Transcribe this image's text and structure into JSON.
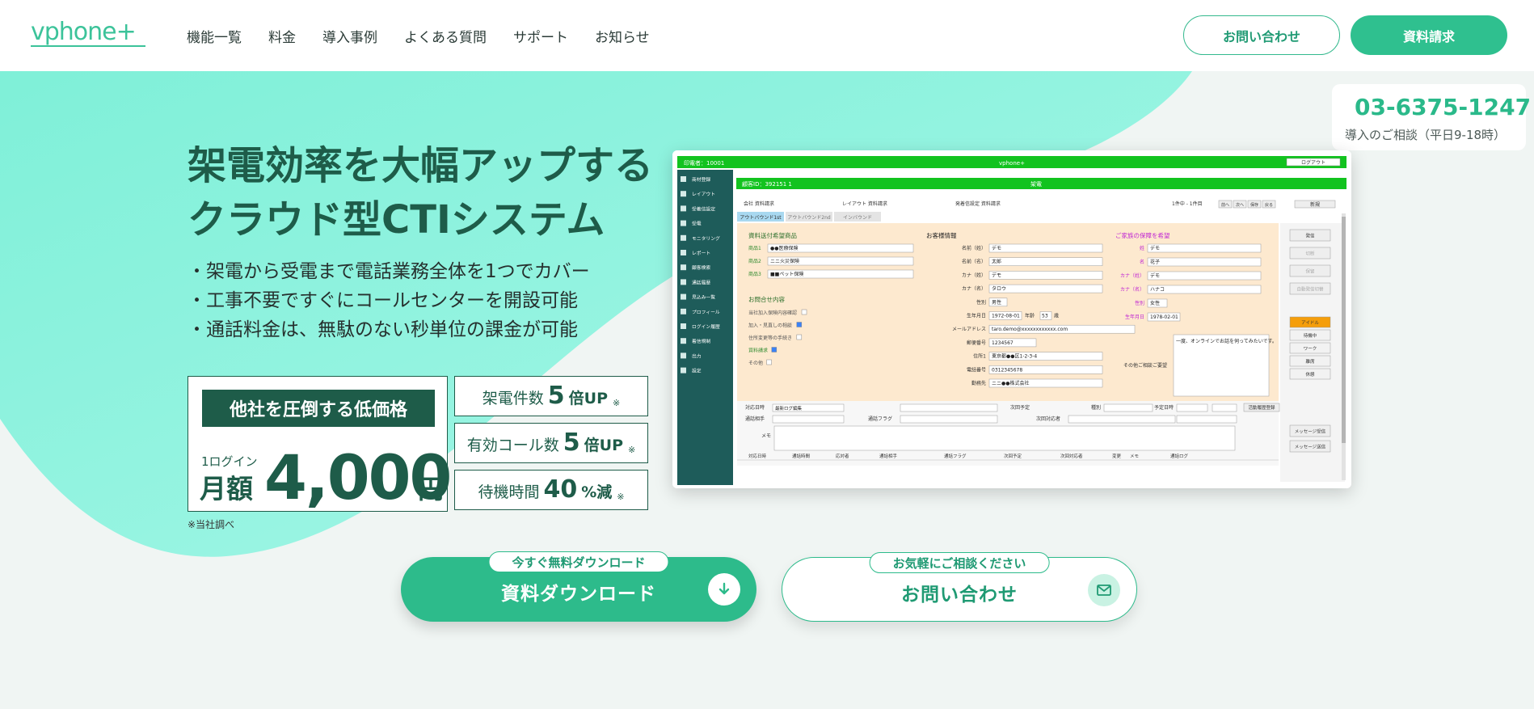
{
  "header": {
    "logo": "vphone+",
    "nav": [
      "機能一覧",
      "料金",
      "導入事例",
      "よくある質問",
      "サポート",
      "お知らせ"
    ],
    "contact_button": "お問い合わせ",
    "document_button": "資料請求"
  },
  "phone": {
    "number": "03-6375-1247",
    "note": "導入のご相談（平日9-18時）"
  },
  "hero": {
    "headline_line1": "架電効率を大幅アップする",
    "headline_line2": "クラウド型CTIシステム",
    "bullets": [
      "・架電から受電まで電話業務全体を1つでカバー",
      "・工事不要ですぐにコールセンターを開設可能",
      "・通話料金は、無駄のない秒単位の課金が可能"
    ]
  },
  "price": {
    "badge": "他社を圧倒する低価格",
    "per_login": "1ログイン",
    "monthly": "月額",
    "amount": "4,000",
    "unit": "円",
    "footnote": "※当社調べ"
  },
  "stats": [
    {
      "label": "架電件数",
      "num": "5",
      "unit": "倍UP",
      "mark": "※"
    },
    {
      "label": "有効コール数",
      "num": "5",
      "unit": "倍UP",
      "mark": "※"
    },
    {
      "label": "待機時間",
      "num": "40",
      "unit": "%減",
      "mark": "※"
    }
  ],
  "screenshot": {
    "topbar_left": "印電者：10001",
    "topbar_center": "vphone+",
    "topbar_right": "ログアウト",
    "customer_id": "顧客ID：392151 1",
    "title_center": "架電",
    "tabs": [
      "アウトバウンド1st",
      "アウトバウンド2nd",
      "インバウンド"
    ],
    "sidebar": [
      "商材登録",
      "レイアウト",
      "受着信設定",
      "受電",
      "モニタリング",
      "レポート",
      "顧客検索",
      "通話履歴",
      "見込み一覧",
      "プロフィール",
      "ログイン履歴",
      "着信規制",
      "出力",
      "設定"
    ],
    "section_product": "資料送付希望商品",
    "section_inquiry": "お問合せ内容",
    "section_customer": "お客様情報",
    "section_family": "ご家族の保障を希望",
    "products": [
      "●●医療保険",
      "ニニ火災保険",
      "■■ペット保険"
    ],
    "product_labels": [
      "商品1",
      "商品2",
      "商品3"
    ],
    "inquiry_items": [
      "当社加入保険内容確認",
      "加入・見直しの相談",
      "住所変更等の手続き",
      "資料請求",
      "その他"
    ],
    "customer_labels": [
      "名前（姓）",
      "名前（名）",
      "カナ（姓）",
      "カナ（名）",
      "性別",
      "生年月日",
      "メールアドレス",
      "郵便番号",
      "住所1",
      "電話番号",
      "勤務先"
    ],
    "customer_values": [
      "デモ",
      "太郎",
      "デモ",
      "タロウ",
      "男性",
      "1972-08-01",
      "taro.demo@xxxxxxxxxxxx.com",
      "1234567",
      "東京都●●区1-2-3-4",
      "0312345678",
      "ニニ●●株式会社"
    ],
    "age_label": "年齢",
    "age_value": "53",
    "age_unit": "歳",
    "family_labels": [
      "姓",
      "名",
      "カナ（姓）",
      "カナ（名）",
      "性別",
      "生年月日"
    ],
    "family_values": [
      "デモ",
      "花子",
      "デモ",
      "ハナコ",
      "女性",
      "1978-02-01"
    ],
    "consult_label": "その他ご相談ご要望",
    "consult_text": "一度、オンラインでお話を伺ってみたいです。",
    "right_buttons": [
      "発信",
      "切断",
      "保留",
      "自動発信切替"
    ],
    "status_buttons": [
      "アイドル",
      "待機中",
      "ワーク",
      "離席",
      "休憩"
    ],
    "message_buttons": [
      "メッセージ受信",
      "メッセージ送信"
    ],
    "bottom_labels": [
      "対応日時",
      "通話フラググループ",
      "次回予定",
      "種別",
      "予定日時",
      "通話相手",
      "通話フラグ",
      "次回対応者",
      "メモ"
    ],
    "bottom_value_first": "最新ログ編集",
    "bottom_button": "活動履歴登録",
    "table_headers": [
      "対応日時",
      "通話時間",
      "応対者",
      "通話相手",
      "通話フラグ",
      "次回予定",
      "次回対応者",
      "変更",
      "メモ",
      "通話ログ"
    ],
    "counter": "1件中 - 1件目",
    "nav_buttons": [
      "前へ",
      "次へ",
      "保存",
      "戻る"
    ],
    "new_button": "新規",
    "info_row": [
      "会社 資料請求",
      "レイアウト 資料請求",
      "発着信設定 資料請求"
    ]
  },
  "cta": {
    "download_tag": "今すぐ無料ダウンロード",
    "download_label": "資料ダウンロード",
    "contact_tag": "お気軽にご相談ください",
    "contact_label": "お問い合わせ"
  },
  "colors": {
    "brand": "#2fc08f",
    "dark": "#1e5c49",
    "hero_mint": "#8ff2de",
    "app_green": "#12c31f"
  }
}
